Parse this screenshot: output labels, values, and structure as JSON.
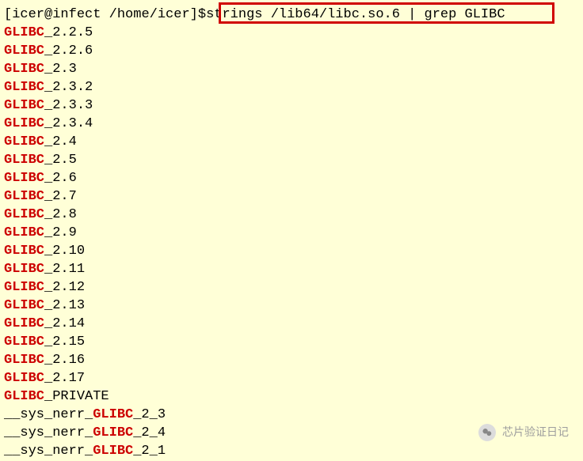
{
  "prompt": {
    "user": "icer",
    "host": "infect",
    "path": "/home/icer",
    "symbol": "$",
    "command": "strings /lib64/libc.so.6 | grep GLIBC"
  },
  "lines": [
    {
      "hl": "GLIBC",
      "rest": "_2.2.5"
    },
    {
      "hl": "GLIBC",
      "rest": "_2.2.6"
    },
    {
      "hl": "GLIBC",
      "rest": "_2.3"
    },
    {
      "hl": "GLIBC",
      "rest": "_2.3.2"
    },
    {
      "hl": "GLIBC",
      "rest": "_2.3.3"
    },
    {
      "hl": "GLIBC",
      "rest": "_2.3.4"
    },
    {
      "hl": "GLIBC",
      "rest": "_2.4"
    },
    {
      "hl": "GLIBC",
      "rest": "_2.5"
    },
    {
      "hl": "GLIBC",
      "rest": "_2.6"
    },
    {
      "hl": "GLIBC",
      "rest": "_2.7"
    },
    {
      "hl": "GLIBC",
      "rest": "_2.8"
    },
    {
      "hl": "GLIBC",
      "rest": "_2.9"
    },
    {
      "hl": "GLIBC",
      "rest": "_2.10"
    },
    {
      "hl": "GLIBC",
      "rest": "_2.11"
    },
    {
      "hl": "GLIBC",
      "rest": "_2.12"
    },
    {
      "hl": "GLIBC",
      "rest": "_2.13"
    },
    {
      "hl": "GLIBC",
      "rest": "_2.14"
    },
    {
      "hl": "GLIBC",
      "rest": "_2.15"
    },
    {
      "hl": "GLIBC",
      "rest": "_2.16"
    },
    {
      "hl": "GLIBC",
      "rest": "_2.17"
    },
    {
      "hl": "GLIBC",
      "rest": "_PRIVATE"
    }
  ],
  "symlines": [
    {
      "pre": "__sys_nerr_",
      "hl": "GLIBC",
      "rest": "_2_3"
    },
    {
      "pre": "__sys_nerr_",
      "hl": "GLIBC",
      "rest": "_2_4"
    },
    {
      "pre": "__sys_nerr_",
      "hl": "GLIBC",
      "rest": "_2_1"
    }
  ],
  "watermark": {
    "text": "芯片验证日记"
  }
}
